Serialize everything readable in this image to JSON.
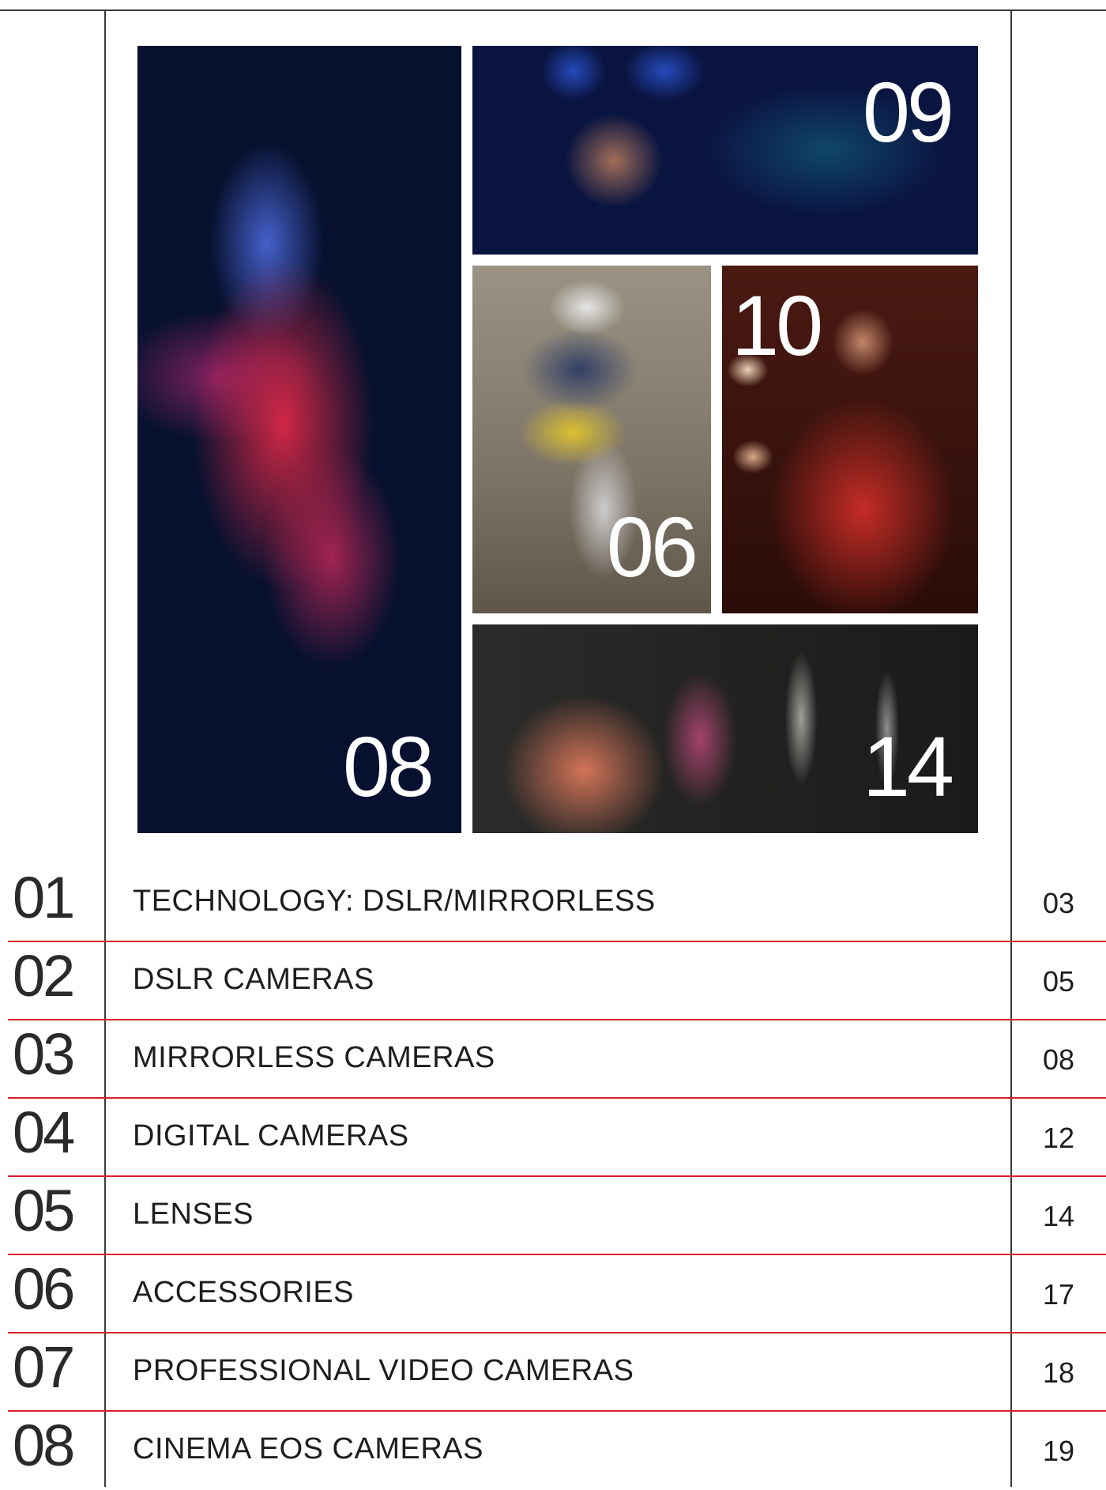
{
  "gallery": {
    "photo_08": "08",
    "photo_09": "09",
    "photo_06": "06",
    "photo_10": "10",
    "photo_14": "14"
  },
  "toc": [
    {
      "num": "01",
      "title": "TECHNOLOGY: DSLR/MIRRORLESS",
      "page": "03"
    },
    {
      "num": "02",
      "title": "DSLR CAMERAS",
      "page": "05"
    },
    {
      "num": "03",
      "title": "MIRRORLESS CAMERAS",
      "page": "08"
    },
    {
      "num": "04",
      "title": "DIGITAL CAMERAS",
      "page": "12"
    },
    {
      "num": "05",
      "title": "LENSES",
      "page": "14"
    },
    {
      "num": "06",
      "title": "ACCESSORIES",
      "page": "17"
    },
    {
      "num": "07",
      "title": "PROFESSIONAL VIDEO CAMERAS",
      "page": "18"
    },
    {
      "num": "08",
      "title": "CINEMA EOS CAMERAS",
      "page": "19"
    }
  ],
  "colors": {
    "separator": "#d8202b",
    "frame": "#3a3a3a",
    "text": "#1e1e1e"
  }
}
